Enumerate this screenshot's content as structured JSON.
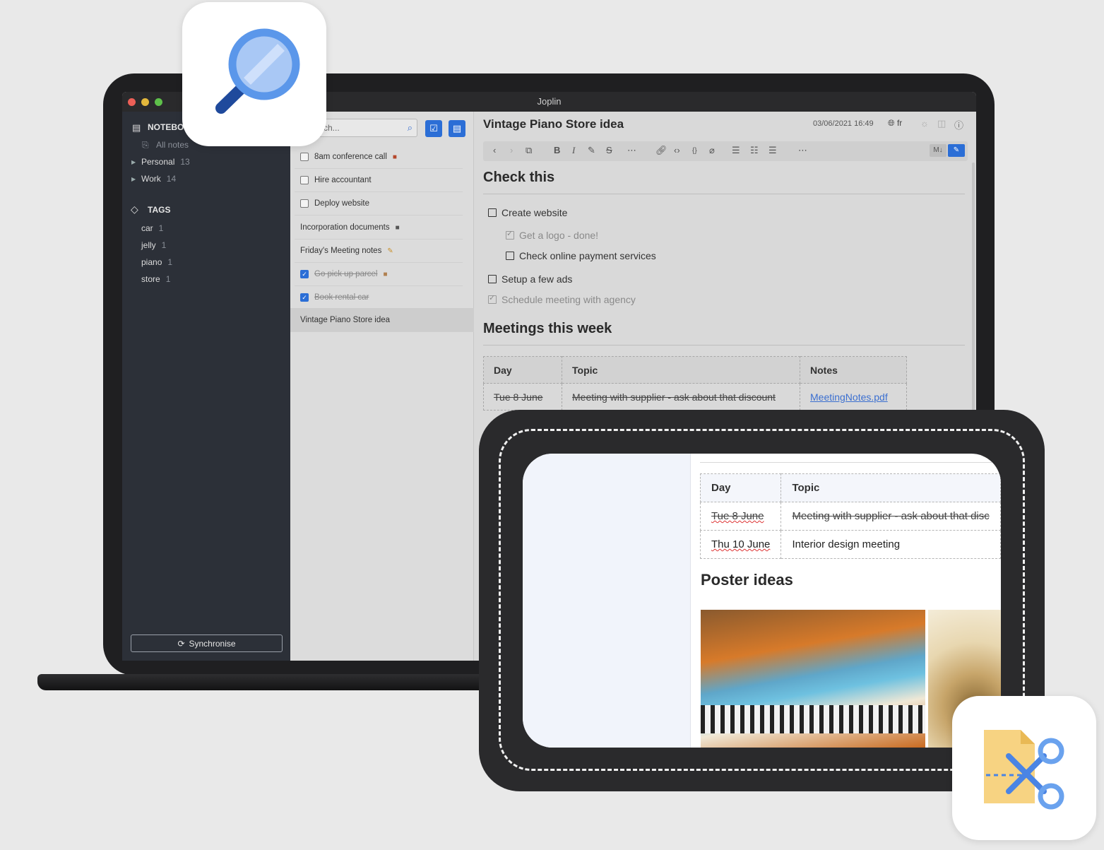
{
  "window": {
    "title": "Joplin"
  },
  "sidebar": {
    "notebooks_heading": "NOTEBO",
    "all_notes": "All notes",
    "notebooks": [
      {
        "label": "Personal",
        "count": "13"
      },
      {
        "label": "Work",
        "count": "14"
      }
    ],
    "tags_heading": "TAGS",
    "tags": [
      {
        "label": "car",
        "count": "1"
      },
      {
        "label": "jelly",
        "count": "1"
      },
      {
        "label": "piano",
        "count": "1"
      },
      {
        "label": "store",
        "count": "1"
      }
    ],
    "sync_label": "Synchronise"
  },
  "notelist": {
    "search_placeholder": "rch...",
    "items": [
      {
        "label": "8am conference call",
        "todo": true,
        "done": false
      },
      {
        "label": "Hire accountant",
        "todo": true,
        "done": false
      },
      {
        "label": "Deploy website",
        "todo": true,
        "done": false
      },
      {
        "label": "Incorporation documents",
        "todo": false,
        "done": false
      },
      {
        "label": "Friday's Meeting notes",
        "todo": false,
        "done": false
      },
      {
        "label": "Go pick up parcel",
        "todo": true,
        "done": true
      },
      {
        "label": "Book rental car",
        "todo": true,
        "done": true
      },
      {
        "label": "Vintage Piano Store idea",
        "todo": false,
        "done": false,
        "selected": true
      }
    ]
  },
  "editor": {
    "title": "Vintage Piano Store idea",
    "date": "03/06/2021 16:49",
    "lang": "fr",
    "heading1": "Check this",
    "todos": [
      {
        "label": "Create website",
        "done": false
      },
      {
        "label": "Get a logo - done!",
        "done": true
      },
      {
        "label": "Check online payment services",
        "done": false
      },
      {
        "label": "Setup a few ads",
        "done": false
      },
      {
        "label": "Schedule meeting with agency",
        "done": true
      }
    ],
    "heading2": "Meetings this week",
    "table": {
      "headers": [
        "Day",
        "Topic",
        "Notes"
      ],
      "row": [
        "Tue 8 June",
        "Meeting with supplier - ask about that discount",
        "MeetingNotes.pdf"
      ]
    }
  },
  "mobile": {
    "table": {
      "headers": [
        "Day",
        "Topic"
      ],
      "rows": [
        [
          "Tue 8 June",
          "Meeting with supplier - ask about that disc"
        ],
        [
          "Thu 10 June",
          "Interior design meeting"
        ]
      ]
    },
    "heading": "Poster ideas"
  },
  "colors": {
    "accent": "#2b6ed6",
    "sidebar": "#2c3038",
    "icon_blue": "#6aa2ee"
  }
}
